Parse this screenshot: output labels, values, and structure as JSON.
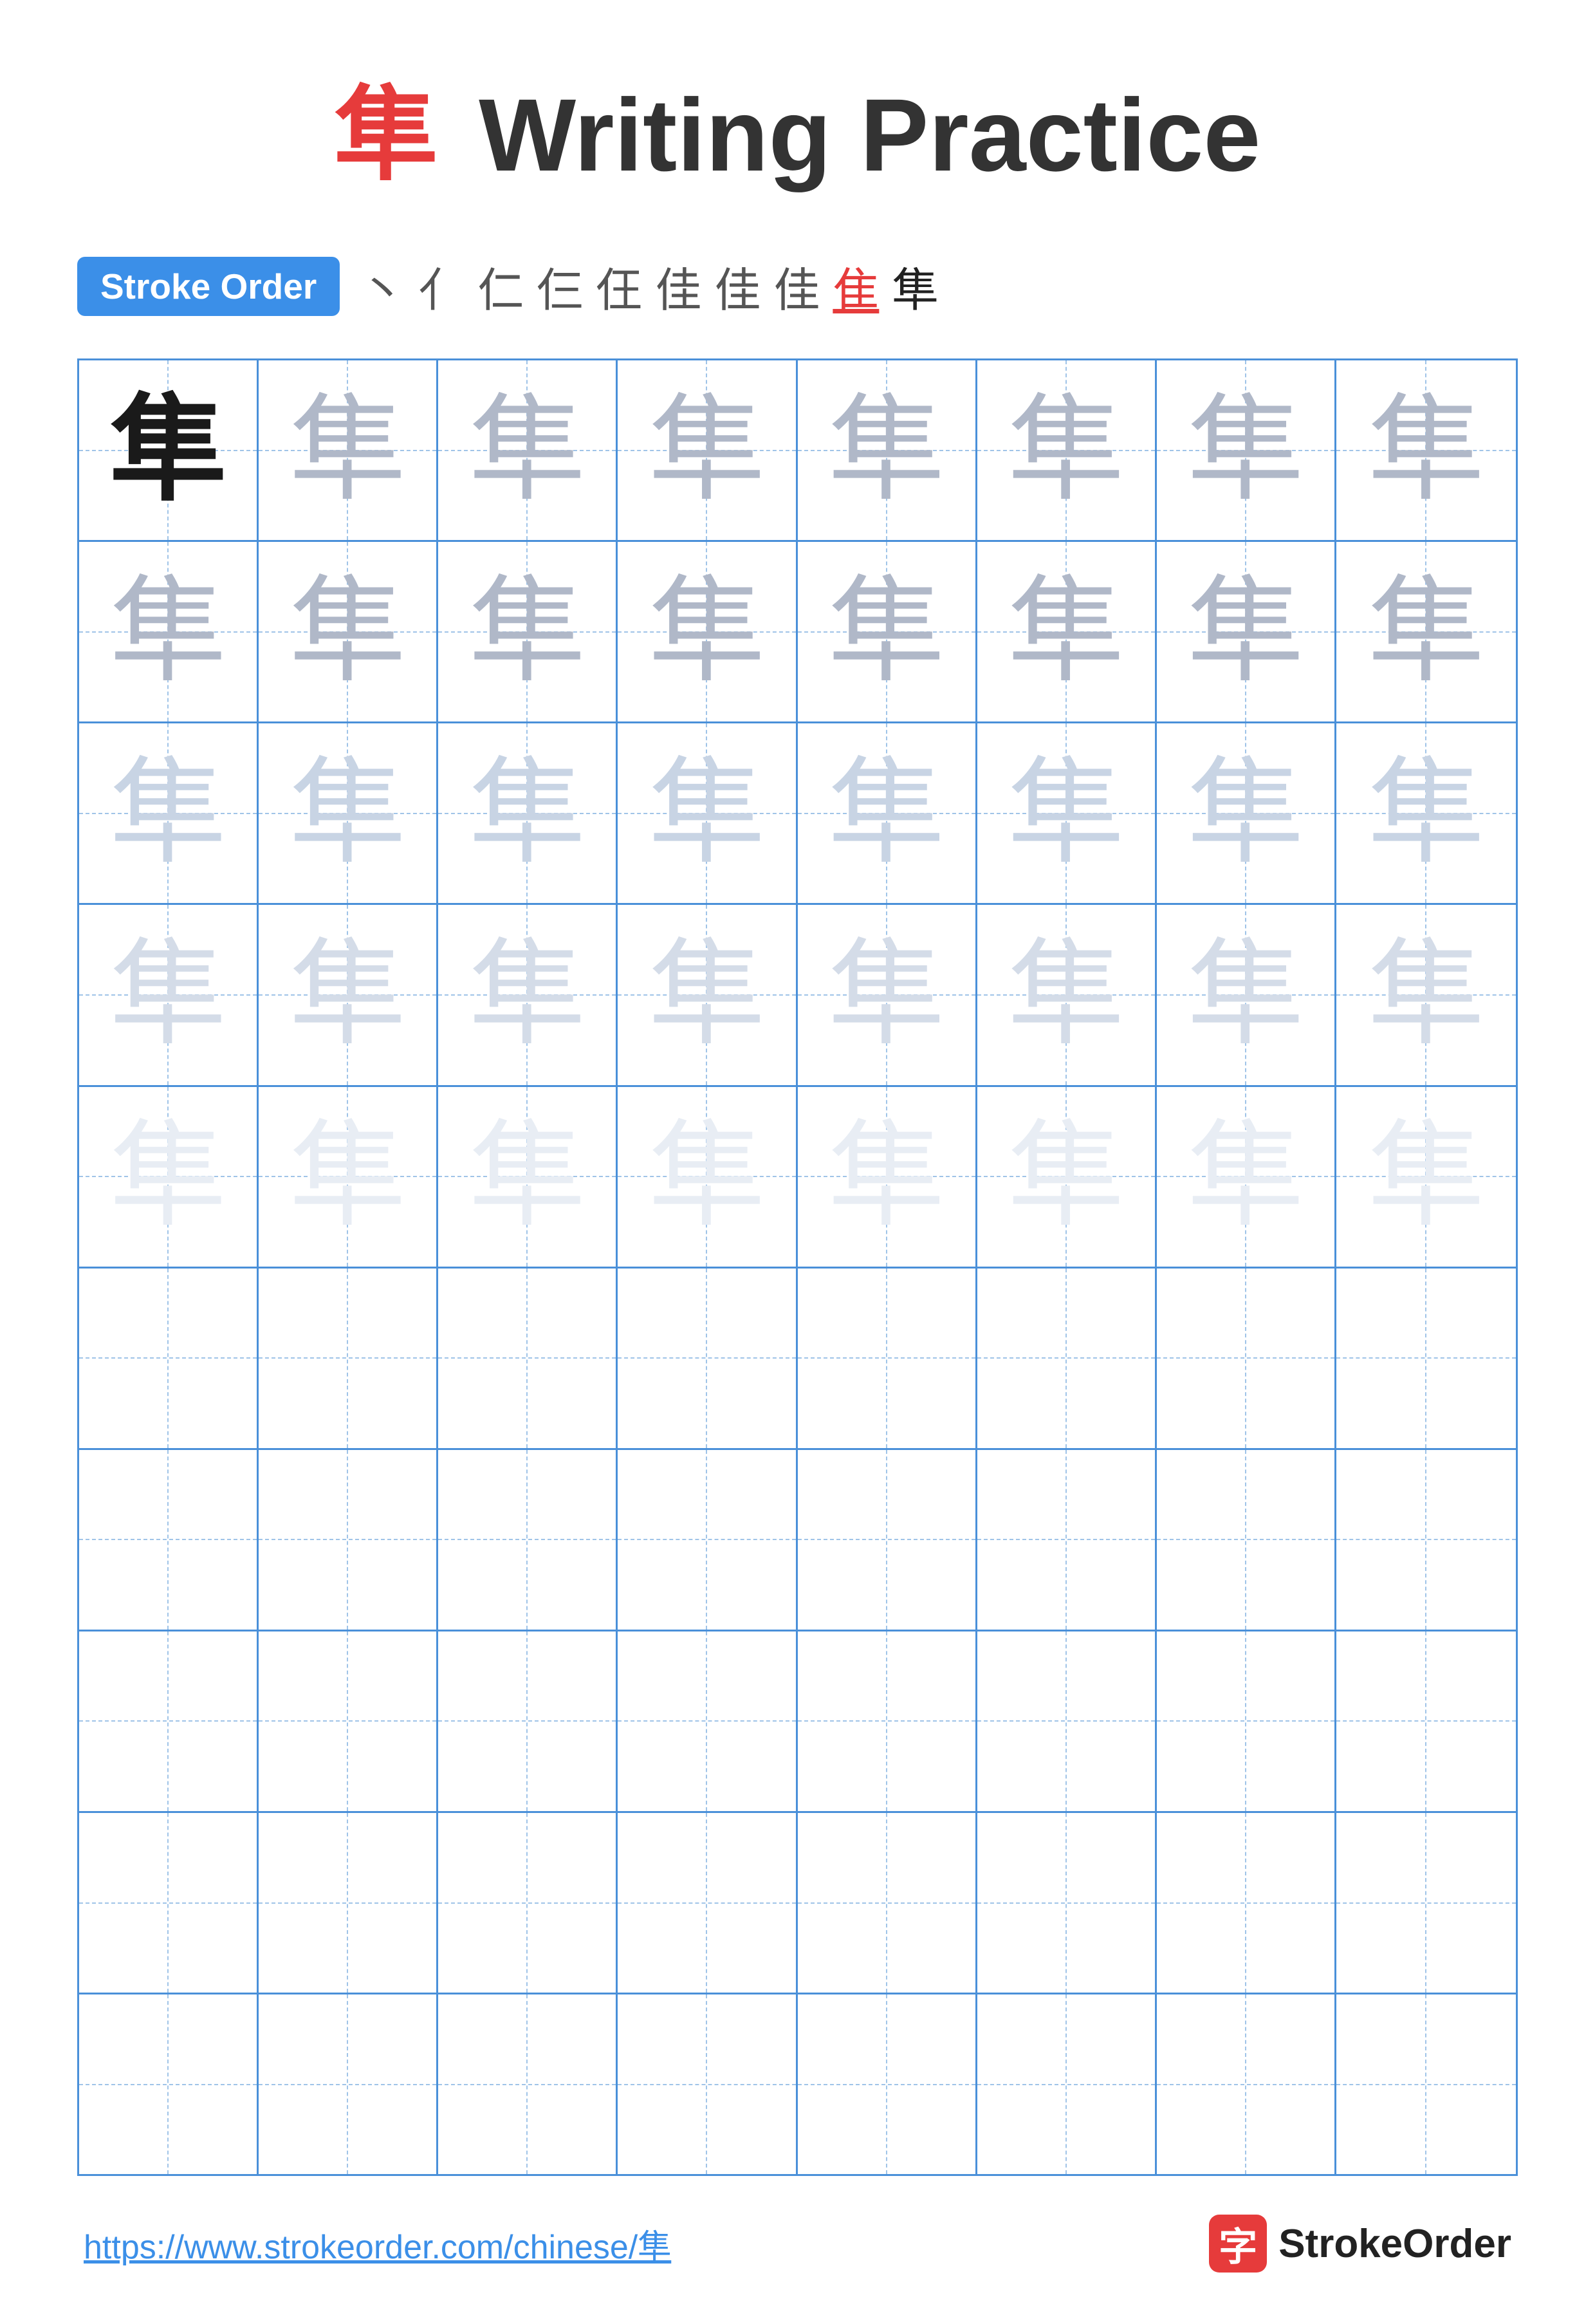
{
  "page": {
    "title": {
      "char": "隼",
      "text": " Writing Practice"
    },
    "stroke_order": {
      "badge_label": "Stroke Order",
      "strokes": [
        "丶",
        "亻",
        "仁",
        "仨",
        "仼",
        "佳",
        "佳",
        "佳",
        "隹",
        "隼"
      ]
    },
    "grid": {
      "rows": 10,
      "cols": 8,
      "char": "隼",
      "dark_row": 0,
      "dark_col": 0,
      "medium_rows": [
        1,
        2,
        3
      ],
      "light_rows": [
        4
      ],
      "vlight_rows": [
        5,
        6,
        7,
        8,
        9
      ]
    },
    "footer": {
      "url": "https://www.strokeorder.com/chinese/隼",
      "logo_char": "字",
      "logo_name": "StrokeOrder"
    }
  }
}
